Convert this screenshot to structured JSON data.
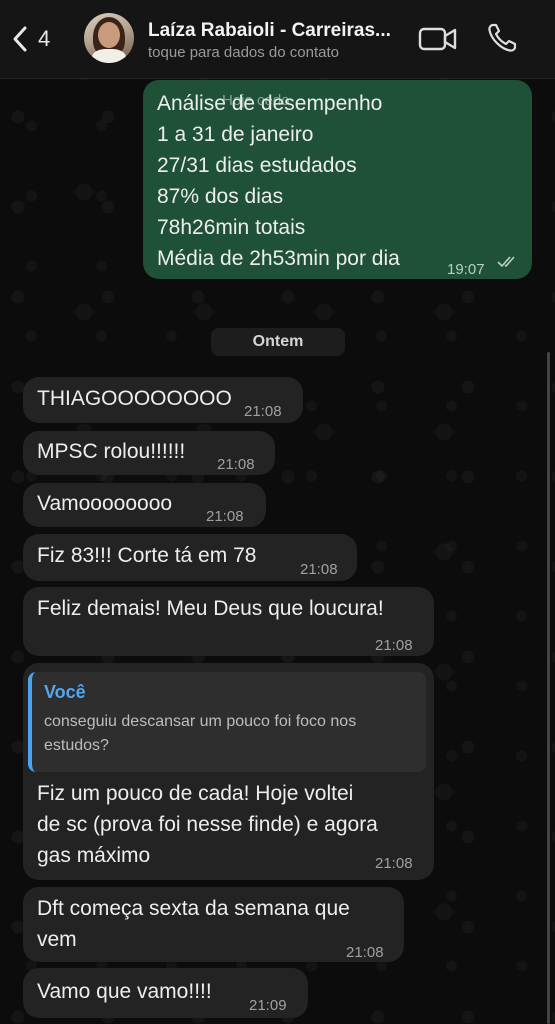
{
  "header": {
    "back_count": "4",
    "contact_name": "Laíza Rabaioli - Carreiras...",
    "contact_subtitle": "toque para dados do contato"
  },
  "outgoing_summary": {
    "overlay_label": "Hoje cedo",
    "lines": [
      "Análise de desempenho",
      "1 a 31 de janeiro",
      "27/31 dias estudados",
      "87% dos dias",
      "78h26min totais",
      "Média de 2h53min por dia"
    ],
    "time": "19:07"
  },
  "date_separator": "Ontem",
  "messages": [
    {
      "text": "THIAGOOOOOOOO",
      "time": "21:08"
    },
    {
      "text": "MPSC rolou!!!!!!",
      "time": "21:08"
    },
    {
      "text": "Vamoooooooo",
      "time": "21:08"
    },
    {
      "text": "Fiz 83!!! Corte tá em 78",
      "time": "21:08"
    },
    {
      "text": "Feliz demais! Meu Deus que loucura!",
      "time": "21:08"
    },
    {
      "quote_author": "Você",
      "quote_text": "conseguiu descansar um pouco foi foco nos estudos?",
      "lines": [
        "Fiz um pouco de cada! Hoje voltei",
        "de sc (prova foi nesse finde) e agora",
        "gas máximo"
      ],
      "time": "21:08"
    },
    {
      "lines": [
        "Dft começa sexta da semana que",
        "vem"
      ],
      "time": "21:08"
    },
    {
      "text": "Vamo que vamo!!!!",
      "time": "21:09"
    }
  ],
  "colors": {
    "incoming_bubble": "#232323",
    "outgoing_bubble": "#1f5138",
    "quote_accent": "#4aa3f0",
    "header_bg": "#151515"
  },
  "icons": [
    "chevron-left-icon",
    "video-camera-icon",
    "phone-icon",
    "double-check-icon"
  ]
}
